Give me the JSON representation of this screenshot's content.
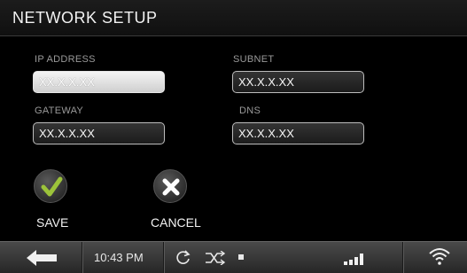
{
  "header": {
    "title": "NETWORK SETUP"
  },
  "fields": {
    "ip": {
      "label": "IP ADDRESS",
      "value": "XX.X.X.XX"
    },
    "subnet": {
      "label": "SUBNET",
      "value": "XX.X.X.XX"
    },
    "gateway": {
      "label": "GATEWAY",
      "value": "XX.X.X.XX"
    },
    "dns": {
      "label": "DNS",
      "value": "XX.X.X.XX"
    }
  },
  "actions": {
    "save_label": "SAVE",
    "cancel_label": "CANCEL"
  },
  "taskbar": {
    "time": "10:43 PM",
    "icons": [
      "back-arrow-icon",
      "refresh-icon",
      "shuffle-icon",
      "stop-icon",
      "signal-bars-icon",
      "wifi-icon"
    ]
  },
  "colors": {
    "check_green": "#9cc33a",
    "background": "#000000"
  }
}
